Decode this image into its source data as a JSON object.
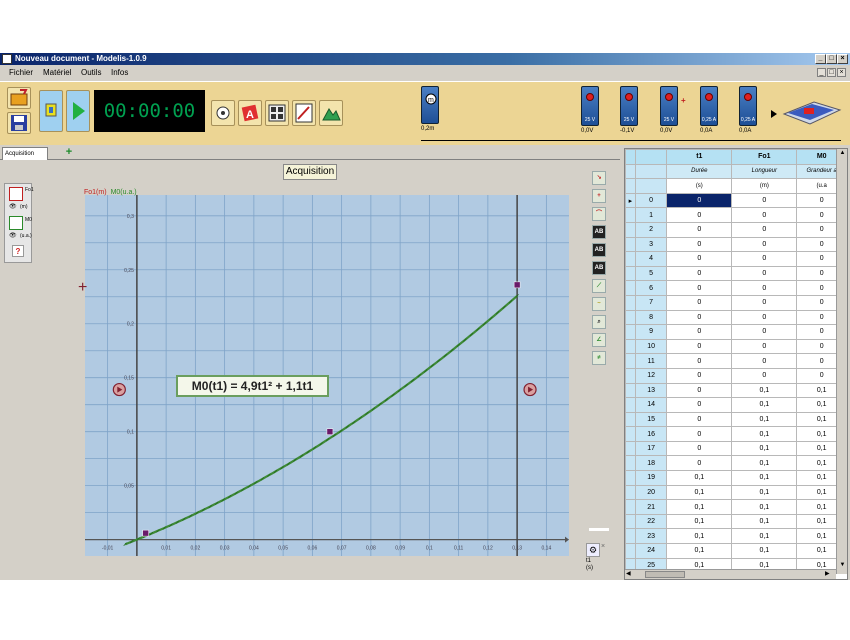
{
  "window": {
    "title": "Nouveau document - Modelis-1.0.9"
  },
  "menu": {
    "items": [
      "Fichier",
      "Matériel",
      "Outils",
      "Infos"
    ]
  },
  "toolbar": {
    "timer": "00:00:00"
  },
  "sensors": [
    {
      "name": "Fo1",
      "value": "0,2m"
    },
    {
      "label": "25 V",
      "value": "0,0V"
    },
    {
      "label": "25 V",
      "value": "-0,1V"
    },
    {
      "label": "25 V",
      "value": "0,0V"
    },
    {
      "label": "0,25 A",
      "value": "0,0A"
    },
    {
      "label": "0,25 A",
      "value": "0,0A"
    }
  ],
  "tabs": {
    "acquisition": "Acquisition",
    "add": "+"
  },
  "left_panel": {
    "series1": {
      "name": "Fo1",
      "unit": "(m)"
    },
    "series2": {
      "name": "M0",
      "unit": "(u.a.)"
    },
    "help": "?"
  },
  "acquisition_button": "Acquisition",
  "chart": {
    "y_title_a": "Fo1(m)",
    "y_title_b": "M0(u.a.)",
    "equation": "M0(t1) = 4,9t1² + 1,1t1",
    "x_unit_name": "t1",
    "x_unit": "(s)",
    "colors": {
      "background": "#b1cae2",
      "grid": "#7fa3c8",
      "curve": "#3f8a38",
      "marker": "#6a1a6a"
    }
  },
  "chart_data": {
    "type": "line",
    "xlabel": "t1 (s)",
    "ylabel": "Fo1(m)",
    "xlim": [
      -0.015,
      0.145
    ],
    "ylim": [
      -0.005,
      0.31
    ],
    "x_ticks": [
      "-0,01",
      "0,01",
      "0,02",
      "0,03",
      "0,04",
      "0,05",
      "0,06",
      "0,07",
      "0,08",
      "0,09",
      "0,1",
      "0,11",
      "0,12",
      "0,13",
      "0,14"
    ],
    "x_tick_values": [
      -0.01,
      0.01,
      0.02,
      0.03,
      0.04,
      0.05,
      0.06,
      0.07,
      0.08,
      0.09,
      0.1,
      0.11,
      0.12,
      0.13,
      0.14
    ],
    "y_ticks": [
      "0,05",
      "0,1",
      "0,15",
      "0,2",
      "0,25",
      "0,3"
    ],
    "y_tick_values": [
      0.05,
      0.1,
      0.15,
      0.2,
      0.25,
      0.3
    ],
    "series": [
      {
        "name": "M0",
        "model": "M0(t1) = 4,9t1² + 1,1t1"
      }
    ],
    "markers": [
      {
        "x": 0.003,
        "y": 0.006
      },
      {
        "x": 0.066,
        "y": 0.1
      },
      {
        "x": 0.13,
        "y": 0.236
      }
    ],
    "vertical_lines": [
      0.0,
      0.13
    ],
    "grid": true
  },
  "table": {
    "columns": [
      {
        "name": "t1",
        "desc": "Durée",
        "unit": "(s)"
      },
      {
        "name": "Fo1",
        "desc": "Longueur",
        "unit": "(m)"
      },
      {
        "name": "M0",
        "desc": "Grandeur a",
        "unit": "(u.a"
      }
    ],
    "rows": [
      [
        "0",
        "0",
        "0",
        "0"
      ],
      [
        "1",
        "0",
        "0",
        "0"
      ],
      [
        "2",
        "0",
        "0",
        "0"
      ],
      [
        "3",
        "0",
        "0",
        "0"
      ],
      [
        "4",
        "0",
        "0",
        "0"
      ],
      [
        "5",
        "0",
        "0",
        "0"
      ],
      [
        "6",
        "0",
        "0",
        "0"
      ],
      [
        "7",
        "0",
        "0",
        "0"
      ],
      [
        "8",
        "0",
        "0",
        "0"
      ],
      [
        "9",
        "0",
        "0",
        "0"
      ],
      [
        "10",
        "0",
        "0",
        "0"
      ],
      [
        "11",
        "0",
        "0",
        "0"
      ],
      [
        "12",
        "0",
        "0",
        "0"
      ],
      [
        "13",
        "0",
        "0,1",
        "0,1"
      ],
      [
        "14",
        "0",
        "0,1",
        "0,1"
      ],
      [
        "15",
        "0",
        "0,1",
        "0,1"
      ],
      [
        "16",
        "0",
        "0,1",
        "0,1"
      ],
      [
        "17",
        "0",
        "0,1",
        "0,1"
      ],
      [
        "18",
        "0",
        "0,1",
        "0,1"
      ],
      [
        "19",
        "0,1",
        "0,1",
        "0,1"
      ],
      [
        "20",
        "0,1",
        "0,1",
        "0,1"
      ],
      [
        "21",
        "0,1",
        "0,1",
        "0,1"
      ],
      [
        "22",
        "0,1",
        "0,1",
        "0,1"
      ],
      [
        "23",
        "0,1",
        "0,1",
        "0,1"
      ],
      [
        "24",
        "0,1",
        "0,1",
        "0,1"
      ],
      [
        "25",
        "0,1",
        "0,1",
        "0,1"
      ]
    ]
  }
}
